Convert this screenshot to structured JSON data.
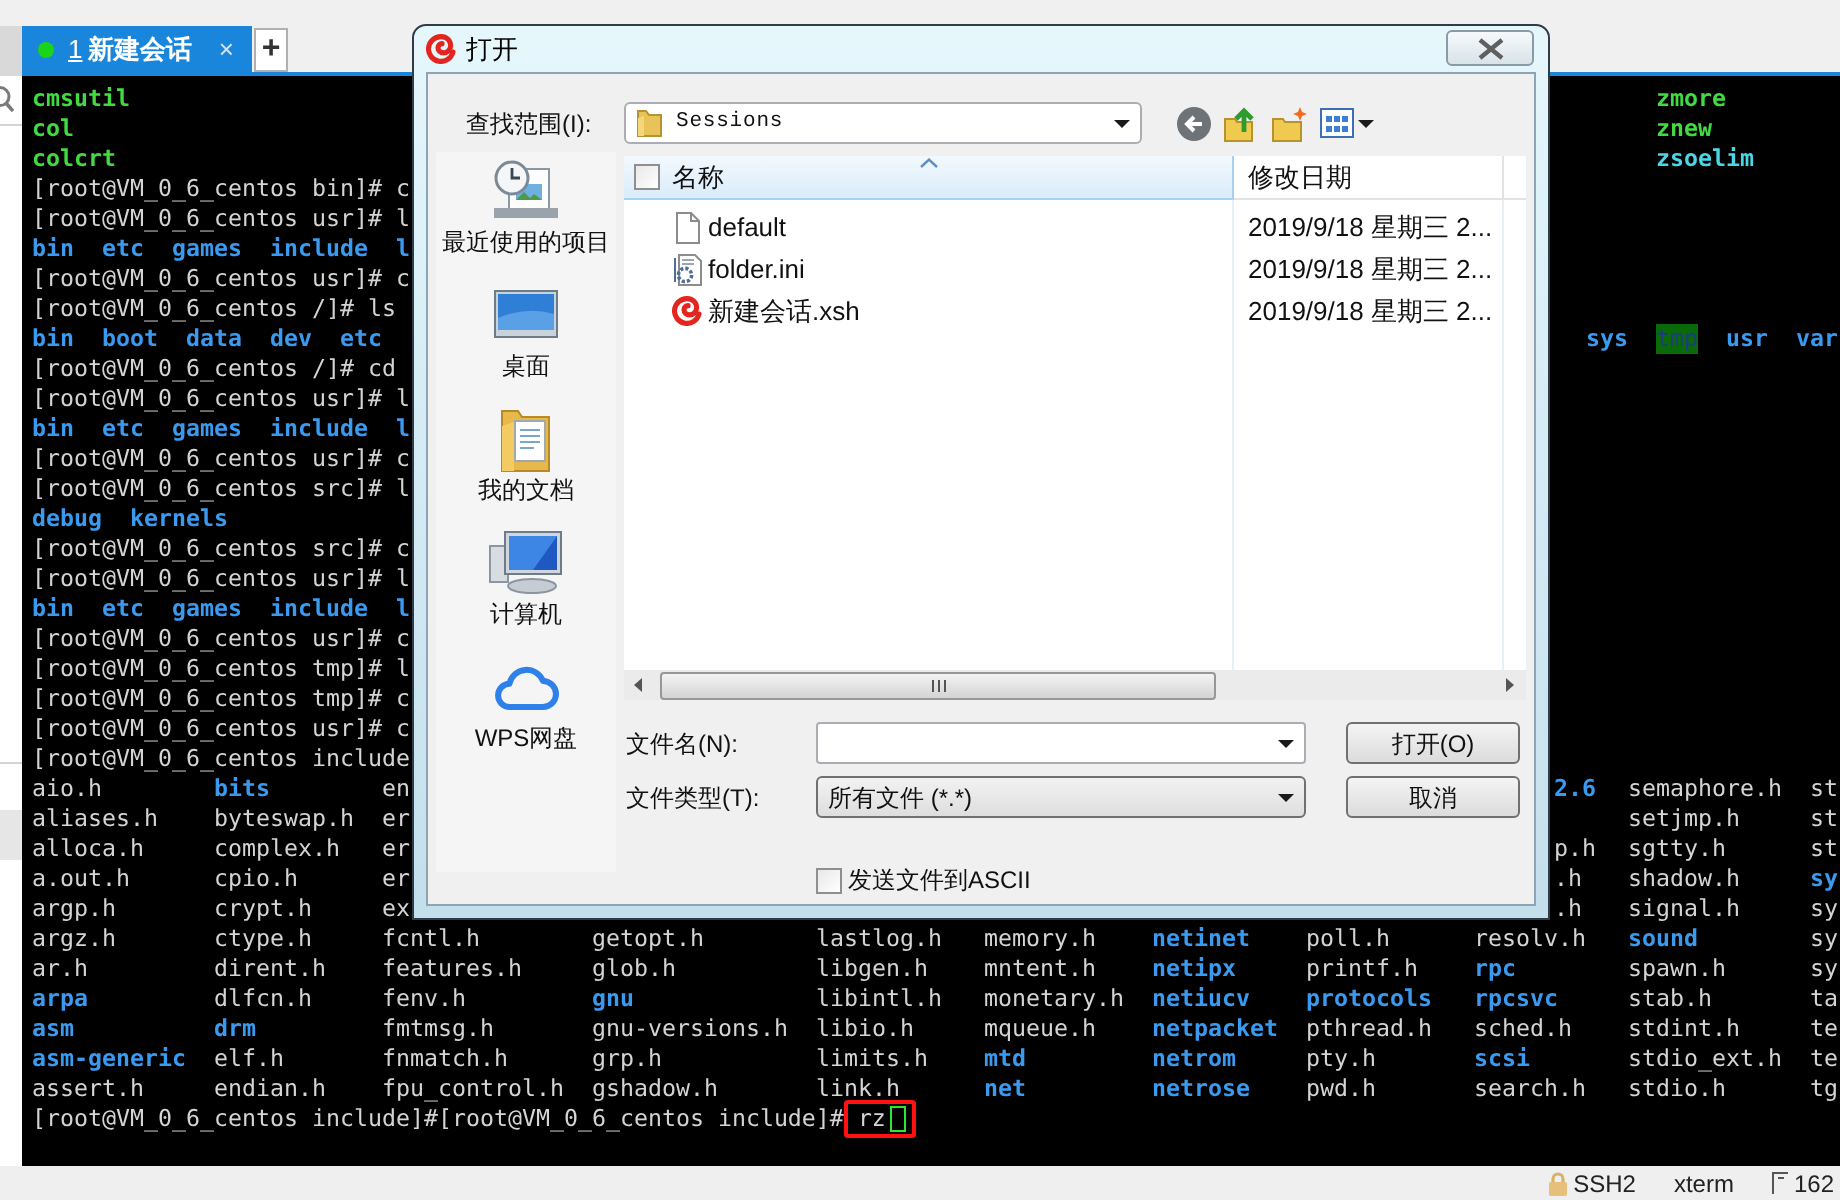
{
  "tabs": [
    {
      "number": "1",
      "label": "新建会话",
      "selected": true,
      "connected": true,
      "close": "×"
    }
  ],
  "new_tab": "+",
  "terminal": {
    "lines": [
      {
        "kind": "output",
        "segment": {
          "kind": "exec",
          "text": "cmsutil"
        },
        "right_column": {
          "kind": "exec",
          "text": "zmore"
        }
      },
      {
        "kind": "output",
        "segment": {
          "kind": "exec",
          "text": "col"
        },
        "right_column": {
          "kind": "exec",
          "text": "znew"
        }
      },
      {
        "kind": "output",
        "segment": {
          "kind": "exec",
          "text": "colcrt"
        },
        "right_column": {
          "kind": "link",
          "text": "zsoelim"
        }
      },
      {
        "kind": "prompt",
        "text": "[root@VM_0_6_centos bin]# c"
      },
      {
        "kind": "prompt",
        "text": "[root@VM_0_6_centos usr]# l"
      },
      {
        "kind": "output",
        "segment": {
          "kind": "dir",
          "text": "bin  etc  games  include  l"
        }
      },
      {
        "kind": "prompt",
        "text": "[root@VM_0_6_centos usr]# c"
      },
      {
        "kind": "prompt",
        "text": "[root@VM_0_6_centos /]# ls"
      },
      {
        "kind": "output",
        "segment": {
          "kind": "dir",
          "text": "bin  boot  data  dev  etc"
        },
        "right_tail": [
          {
            "kind": "dir",
            "text": "sys"
          },
          {
            "kind": "sticky",
            "text": "tmp"
          },
          {
            "kind": "dir",
            "text": "usr"
          },
          {
            "kind": "dir",
            "text": "var"
          }
        ]
      },
      {
        "kind": "prompt",
        "text": "[root@VM_0_6_centos /]# cd"
      },
      {
        "kind": "prompt",
        "text": "[root@VM_0_6_centos usr]# l"
      },
      {
        "kind": "output",
        "segment": {
          "kind": "dir",
          "text": "bin  etc  games  include  l"
        }
      },
      {
        "kind": "prompt",
        "text": "[root@VM_0_6_centos usr]# c"
      },
      {
        "kind": "prompt",
        "text": "[root@VM_0_6_centos src]# l"
      },
      {
        "kind": "output",
        "segment": {
          "kind": "dir",
          "text": "debug  kernels"
        }
      },
      {
        "kind": "prompt",
        "text": "[root@VM_0_6_centos src]# c"
      },
      {
        "kind": "prompt",
        "text": "[root@VM_0_6_centos usr]# l"
      },
      {
        "kind": "output",
        "segment": {
          "kind": "dir",
          "text": "bin  etc  games  include  l"
        }
      },
      {
        "kind": "prompt",
        "text": "[root@VM_0_6_centos usr]# c"
      },
      {
        "kind": "prompt",
        "text": "[root@VM_0_6_centos tmp]# l"
      },
      {
        "kind": "prompt",
        "text": "[root@VM_0_6_centos tmp]# c"
      },
      {
        "kind": "prompt",
        "text": "[root@VM_0_6_centos usr]# c"
      },
      {
        "kind": "prompt",
        "text": "[root@VM_0_6_centos include"
      },
      {
        "kind": "listing_split",
        "cells": [
          {
            "kind": "file",
            "text": "aio.h"
          },
          {
            "kind": "dir",
            "text": "bits"
          },
          {
            "kind": "file",
            "text": "en"
          }
        ],
        "edge": {
          "kind": "dir",
          "text": "2.6"
        },
        "right": [
          {
            "kind": "file",
            "text": "semaphore.h"
          },
          {
            "kind": "file",
            "text": "st"
          }
        ]
      },
      {
        "kind": "listing_split",
        "cells": [
          {
            "kind": "file",
            "text": "aliases.h"
          },
          {
            "kind": "file",
            "text": "byteswap.h"
          },
          {
            "kind": "file",
            "text": "er"
          }
        ],
        "right": [
          {
            "kind": "file",
            "text": "setjmp.h"
          },
          {
            "kind": "file",
            "text": "st"
          }
        ]
      },
      {
        "kind": "listing_split",
        "cells": [
          {
            "kind": "file",
            "text": "alloca.h"
          },
          {
            "kind": "file",
            "text": "complex.h"
          },
          {
            "kind": "file",
            "text": "er"
          }
        ],
        "edge": {
          "kind": "file",
          "text": "p.h"
        },
        "right": [
          {
            "kind": "file",
            "text": "sgtty.h"
          },
          {
            "kind": "file",
            "text": "st"
          }
        ]
      },
      {
        "kind": "listing_split",
        "cells": [
          {
            "kind": "file",
            "text": "a.out.h"
          },
          {
            "kind": "file",
            "text": "cpio.h"
          },
          {
            "kind": "file",
            "text": "er"
          }
        ],
        "edge": {
          "kind": "file",
          "text": ".h"
        },
        "right": [
          {
            "kind": "file",
            "text": "shadow.h"
          },
          {
            "kind": "dir",
            "text": "sy"
          }
        ]
      },
      {
        "kind": "listing_split",
        "cells": [
          {
            "kind": "file",
            "text": "argp.h"
          },
          {
            "kind": "file",
            "text": "crypt.h"
          },
          {
            "kind": "file",
            "text": "ex"
          }
        ],
        "edge": {
          "kind": "file",
          "text": ".h"
        },
        "right": [
          {
            "kind": "file",
            "text": "signal.h"
          },
          {
            "kind": "file",
            "text": "sy"
          }
        ]
      },
      {
        "kind": "listing",
        "cells": [
          {
            "kind": "file",
            "text": "argz.h"
          },
          {
            "kind": "file",
            "text": "ctype.h"
          },
          {
            "kind": "file",
            "text": "fcntl.h"
          },
          {
            "kind": "file",
            "text": "getopt.h"
          },
          {
            "kind": "file",
            "text": "lastlog.h"
          },
          {
            "kind": "file",
            "text": "memory.h"
          },
          {
            "kind": "dir",
            "text": "netinet"
          },
          {
            "kind": "file",
            "text": "poll.h"
          },
          {
            "kind": "file",
            "text": "resolv.h"
          },
          {
            "kind": "dir",
            "text": "sound"
          },
          {
            "kind": "file",
            "text": "sy"
          }
        ]
      },
      {
        "kind": "listing",
        "cells": [
          {
            "kind": "file",
            "text": "ar.h"
          },
          {
            "kind": "file",
            "text": "dirent.h"
          },
          {
            "kind": "file",
            "text": "features.h"
          },
          {
            "kind": "file",
            "text": "glob.h"
          },
          {
            "kind": "file",
            "text": "libgen.h"
          },
          {
            "kind": "file",
            "text": "mntent.h"
          },
          {
            "kind": "dir",
            "text": "netipx"
          },
          {
            "kind": "file",
            "text": "printf.h"
          },
          {
            "kind": "dir",
            "text": "rpc"
          },
          {
            "kind": "file",
            "text": "spawn.h"
          },
          {
            "kind": "file",
            "text": "sy"
          }
        ]
      },
      {
        "kind": "listing",
        "cells": [
          {
            "kind": "dir",
            "text": "arpa"
          },
          {
            "kind": "file",
            "text": "dlfcn.h"
          },
          {
            "kind": "file",
            "text": "fenv.h"
          },
          {
            "kind": "dir",
            "text": "gnu"
          },
          {
            "kind": "file",
            "text": "libintl.h"
          },
          {
            "kind": "file",
            "text": "monetary.h"
          },
          {
            "kind": "dir",
            "text": "netiucv"
          },
          {
            "kind": "dir",
            "text": "protocols"
          },
          {
            "kind": "dir",
            "text": "rpcsvc"
          },
          {
            "kind": "file",
            "text": "stab.h"
          },
          {
            "kind": "file",
            "text": "ta"
          }
        ]
      },
      {
        "kind": "listing",
        "cells": [
          {
            "kind": "dir",
            "text": "asm"
          },
          {
            "kind": "dir",
            "text": "drm"
          },
          {
            "kind": "file",
            "text": "fmtmsg.h"
          },
          {
            "kind": "file",
            "text": "gnu-versions.h"
          },
          {
            "kind": "file",
            "text": "libio.h"
          },
          {
            "kind": "file",
            "text": "mqueue.h"
          },
          {
            "kind": "dir",
            "text": "netpacket"
          },
          {
            "kind": "file",
            "text": "pthread.h"
          },
          {
            "kind": "file",
            "text": "sched.h"
          },
          {
            "kind": "file",
            "text": "stdint.h"
          },
          {
            "kind": "file",
            "text": "te"
          }
        ]
      },
      {
        "kind": "listing",
        "cells": [
          {
            "kind": "dir",
            "text": "asm-generic"
          },
          {
            "kind": "file",
            "text": "elf.h"
          },
          {
            "kind": "file",
            "text": "fnmatch.h"
          },
          {
            "kind": "file",
            "text": "grp.h"
          },
          {
            "kind": "file",
            "text": "limits.h"
          },
          {
            "kind": "dir",
            "text": "mtd"
          },
          {
            "kind": "dir",
            "text": "netrom"
          },
          {
            "kind": "file",
            "text": "pty.h"
          },
          {
            "kind": "dir",
            "text": "scsi"
          },
          {
            "kind": "file",
            "text": "stdio_ext.h"
          },
          {
            "kind": "file",
            "text": "te"
          }
        ]
      },
      {
        "kind": "listing",
        "cells": [
          {
            "kind": "file",
            "text": "assert.h"
          },
          {
            "kind": "file",
            "text": "endian.h"
          },
          {
            "kind": "file",
            "text": "fpu_control.h"
          },
          {
            "kind": "file",
            "text": "gshadow.h"
          },
          {
            "kind": "file",
            "text": "link.h"
          },
          {
            "kind": "dir",
            "text": "net"
          },
          {
            "kind": "dir",
            "text": "netrose"
          },
          {
            "kind": "file",
            "text": "pwd.h"
          },
          {
            "kind": "file",
            "text": "search.h"
          },
          {
            "kind": "file",
            "text": "stdio.h"
          },
          {
            "kind": "file",
            "text": "tg"
          }
        ]
      },
      {
        "kind": "command",
        "text": "[root@VM_0_6_centos include]#[root@VM_0_6_centos include]#",
        "input": "rz",
        "marked": true,
        "cursor": true
      }
    ]
  },
  "dialog": {
    "title": "打开",
    "look_in": {
      "label": "查找范围(I):",
      "value": "Sessions"
    },
    "places": [
      {
        "kind": "recent",
        "label": "最近使用的项目"
      },
      {
        "kind": "desktop",
        "label": "桌面"
      },
      {
        "kind": "documents",
        "label": "我的文档"
      },
      {
        "kind": "computer",
        "label": "计算机"
      },
      {
        "kind": "cloud",
        "label": "WPS网盘"
      }
    ],
    "file_list": {
      "select_all": {
        "checked": false
      },
      "columns": [
        {
          "label": "名称",
          "sorted": true
        },
        {
          "label": "修改日期",
          "sorted": false
        }
      ],
      "rows": [
        {
          "kind": "plain",
          "name": "default",
          "modified": "2019/9/18 星期三 2..."
        },
        {
          "kind": "config",
          "name": "folder.ini",
          "modified": "2019/9/18 星期三 2..."
        },
        {
          "kind": "session",
          "name": "新建会话.xsh",
          "modified": "2019/9/18 星期三 2..."
        }
      ]
    },
    "file_name": {
      "label": "文件名(N):"
    },
    "file_type": {
      "label": "文件类型(T):",
      "value": "所有文件 (*.*)"
    },
    "buttons": [
      "打开(O)",
      "取消"
    ],
    "send_ascii": {
      "label": "发送文件到ASCII",
      "checked": false
    }
  },
  "status_bar": {
    "items": [
      {
        "kind": "secure",
        "text": "SSH2"
      },
      {
        "kind": "plain",
        "text": "xterm"
      },
      {
        "kind": "size",
        "text": "162"
      }
    ]
  }
}
